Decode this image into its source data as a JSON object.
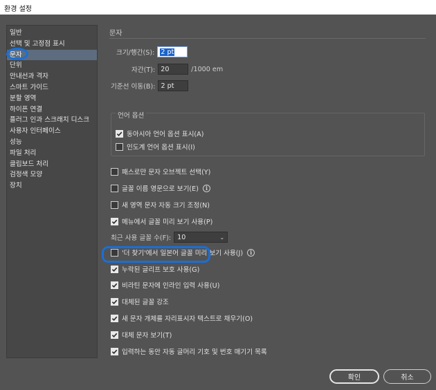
{
  "window": {
    "title": "환경 설정"
  },
  "sidebar": {
    "items": [
      {
        "label": "일반"
      },
      {
        "label": "선택 및 고정점 표시"
      },
      {
        "label": "문자"
      },
      {
        "label": "단위"
      },
      {
        "label": "안내선과 격자"
      },
      {
        "label": "스마트 가이드"
      },
      {
        "label": "분할 영역"
      },
      {
        "label": "하이픈 연결"
      },
      {
        "label": "플러그 인과 스크래치 디스크"
      },
      {
        "label": "사용자 인터페이스"
      },
      {
        "label": "성능"
      },
      {
        "label": "파일 처리"
      },
      {
        "label": "클립보드 처리"
      },
      {
        "label": "검정색 모양"
      },
      {
        "label": "장치"
      }
    ],
    "active_index": 2
  },
  "panel": {
    "section_title": "문자",
    "size_leading_label": "크기/행간(S):",
    "size_leading_value": "2 pt",
    "tracking_label": "자간(T):",
    "tracking_value": "20",
    "tracking_unit": "/1000 em",
    "baseline_label": "기준선 이동(B):",
    "baseline_value": "2 pt",
    "lang_group_title": "언어 옵션",
    "lang_options": [
      {
        "label": "동아시아 언어 옵션 표시(A)",
        "checked": true
      },
      {
        "label": "인도계 언어 옵션 표시(I)",
        "checked": false
      }
    ],
    "options": [
      {
        "label": "패스로만 문자 오브젝트 선택(Y)",
        "checked": false
      },
      {
        "label": "글꼴 이름 영문으로 보기(E)",
        "checked": false,
        "info": true
      },
      {
        "label": "새 영역 문자 자동 크기 조정(N)",
        "checked": false
      },
      {
        "label": "메뉴에서 글꼴 미리 보기 사용(P)",
        "checked": true
      }
    ],
    "recent_fonts_label": "최근 사용 글꼴 수(F):",
    "recent_fonts_value": "10",
    "options2": [
      {
        "label": "'더 찾기'에서 일본어 글꼴 미리 보기 사용(J)",
        "checked": false,
        "info": true
      },
      {
        "label": "누락된 글리프 보호 사용(G)",
        "checked": true
      },
      {
        "label": "비라틴 문자에 인라인 입력 사용(U)",
        "checked": true
      },
      {
        "label": "대체된 글꼴 강조",
        "checked": true
      },
      {
        "label": "새 문자 개체를 자리표시자 텍스트로 채우기(O)",
        "checked": true
      },
      {
        "label": "대체 문자 보기(T)",
        "checked": true
      },
      {
        "label": "입력하는 동안 자동 글머리 기호 및 번호 매기기 목록",
        "checked": true
      }
    ]
  },
  "buttons": {
    "ok": "확인",
    "cancel": "취소"
  },
  "colors": {
    "highlight": "#1a6fd6",
    "dialog_bg": "#535353",
    "active_item": "#5d6d7f"
  },
  "icons": {
    "check": "checkmark-icon",
    "info": "info-icon",
    "dropdown": "chevron-down-icon"
  }
}
